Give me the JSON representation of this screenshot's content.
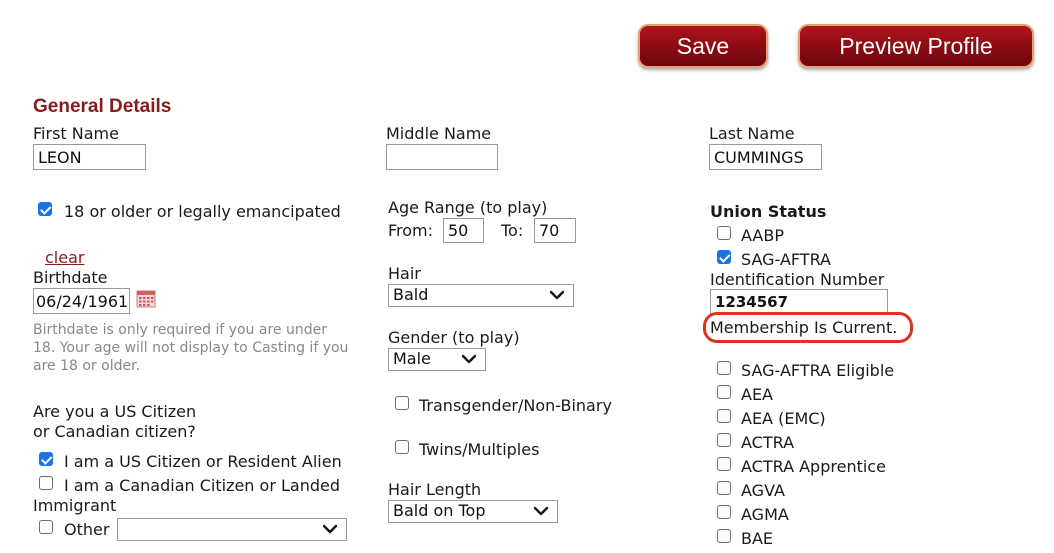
{
  "toolbar": {
    "save_label": "Save",
    "preview_label": "Preview Profile"
  },
  "section": {
    "title": "General Details"
  },
  "name": {
    "first_label": "First Name",
    "first_value": "LEON",
    "middle_label": "Middle Name",
    "middle_value": "",
    "last_label": "Last Name",
    "last_value": "CUMMINGS"
  },
  "age": {
    "eighteen_label": "18 or older or legally emancipated",
    "eighteen_checked": true
  },
  "birthdate": {
    "clear_label": "clear",
    "label": "Birthdate",
    "value": "06/24/1961",
    "help": "Birthdate is only required if you are under 18. Your age will not display to Casting if you are 18 or older."
  },
  "age_range": {
    "label": "Age Range (to play)",
    "from_label": "From:",
    "from_value": "50",
    "to_label": "To:",
    "to_value": "70"
  },
  "hair": {
    "label": "Hair",
    "value": "Bald"
  },
  "gender": {
    "label": "Gender (to play)",
    "value": "Male"
  },
  "identity": {
    "transgender_label": "Transgender/Non-Binary",
    "transgender_checked": false,
    "twins_label": "Twins/Multiples",
    "twins_checked": false
  },
  "hair_length": {
    "label": "Hair Length",
    "value": "Bald on Top"
  },
  "citizen": {
    "question_line1": "Are you a US Citizen",
    "question_line2": "or Canadian citizen?",
    "us_label": "I am a US Citizen or Resident Alien",
    "us_checked": true,
    "ca_label_line1": "I am a Canadian Citizen or Landed",
    "ca_label_line2": "Immigrant",
    "ca_checked": false,
    "other_label": "Other",
    "other_checked": false,
    "other_value": ""
  },
  "union": {
    "title": "Union Status",
    "id_label": "Identification Number",
    "id_value": "1234567",
    "status_text": "Membership Is Current.",
    "items": [
      {
        "label": "AABP",
        "checked": false
      },
      {
        "label": "SAG-AFTRA",
        "checked": true
      },
      {
        "label": "SAG-AFTRA Eligible",
        "checked": false
      },
      {
        "label": "AEA",
        "checked": false
      },
      {
        "label": "AEA (EMC)",
        "checked": false
      },
      {
        "label": "ACTRA",
        "checked": false
      },
      {
        "label": "ACTRA Apprentice",
        "checked": false
      },
      {
        "label": "AGVA",
        "checked": false
      },
      {
        "label": "AGMA",
        "checked": false
      },
      {
        "label": "BAE",
        "checked": false
      }
    ]
  },
  "colors": {
    "accent": "#8b1a1a",
    "button": "#8a0b12",
    "checkbox": "#1a73e8",
    "highlight": "#e0321e"
  }
}
